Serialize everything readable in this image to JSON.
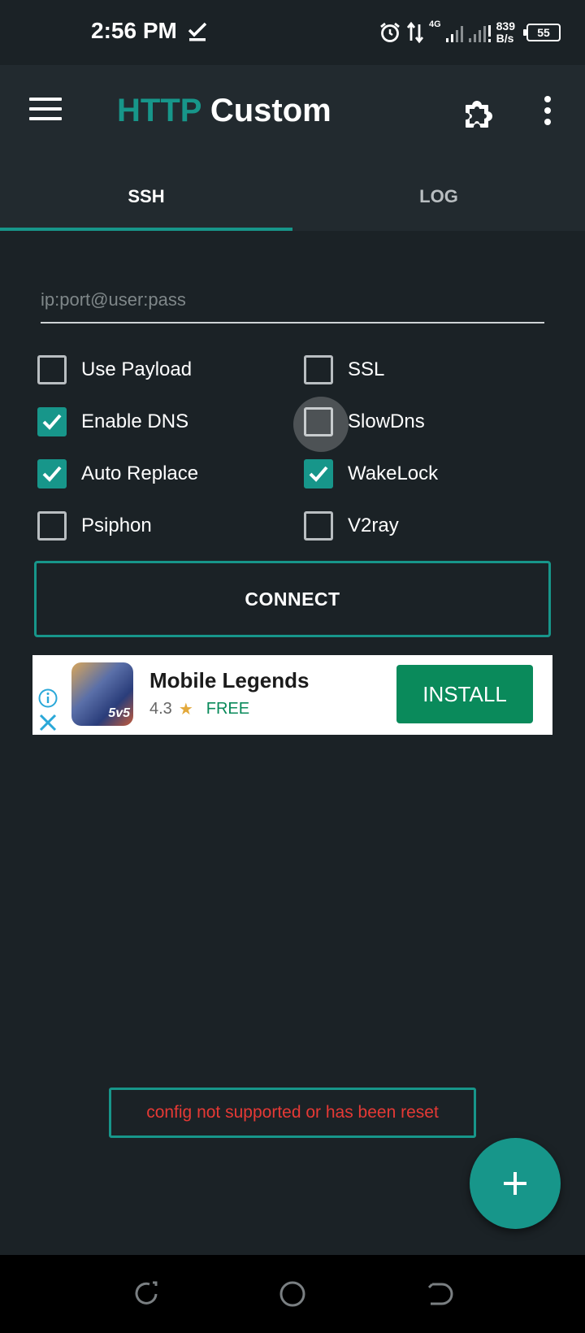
{
  "status_bar": {
    "time": "2:56 PM",
    "network_gen": "4G",
    "net_speed_value": "839",
    "net_speed_unit": "B/s",
    "battery": "55"
  },
  "app_bar": {
    "title_accent": "HTTP",
    "title_rest": " Custom"
  },
  "tabs": [
    {
      "label": "SSH",
      "active": true
    },
    {
      "label": "LOG",
      "active": false
    }
  ],
  "server_input": {
    "placeholder": "ip:port@user:pass",
    "value": ""
  },
  "options": {
    "use_payload": {
      "label": "Use Payload",
      "checked": false
    },
    "ssl": {
      "label": "SSL",
      "checked": false
    },
    "enable_dns": {
      "label": "Enable DNS",
      "checked": true
    },
    "slowdns": {
      "label": "SlowDns",
      "checked": false
    },
    "auto_replace": {
      "label": "Auto Replace",
      "checked": true
    },
    "wakelock": {
      "label": "WakeLock",
      "checked": true
    },
    "psiphon": {
      "label": "Psiphon",
      "checked": false
    },
    "v2ray": {
      "label": "V2ray",
      "checked": false
    }
  },
  "connect_label": "CONNECT",
  "ad": {
    "logo_text": "5v5",
    "title": "Mobile Legends",
    "rating": "4.3",
    "price": "FREE",
    "install_label": "INSTALL"
  },
  "toast": "config not supported or has been reset",
  "colors": {
    "accent": "#17968a",
    "background": "#1b2226",
    "error": "#e53935",
    "install_green": "#0a8a5b"
  }
}
